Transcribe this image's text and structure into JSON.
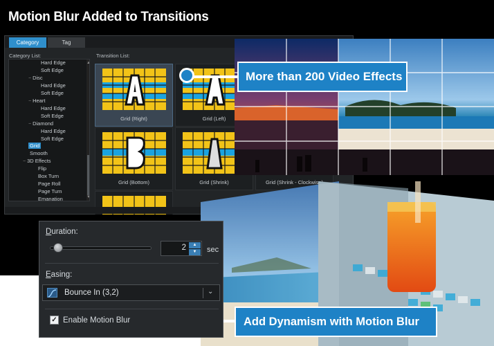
{
  "header": {
    "title": "Motion Blur Added to Transitions"
  },
  "panel": {
    "tabs": [
      {
        "label": "Category"
      },
      {
        "label": "Tag"
      }
    ],
    "category_list_label": "Category List:",
    "transition_list_label": "Transition List:",
    "tree_items": [
      {
        "label": "Hard Edge"
      },
      {
        "label": "Soft Edge"
      },
      {
        "label": "Disc"
      },
      {
        "label": "Hard Edge"
      },
      {
        "label": "Soft Edge"
      },
      {
        "label": "Heart"
      },
      {
        "label": "Hard Edge"
      },
      {
        "label": "Soft Edge"
      },
      {
        "label": "Diamond"
      },
      {
        "label": "Hard Edge"
      },
      {
        "label": "Soft Edge"
      },
      {
        "label": "Grid"
      },
      {
        "label": "Smooth"
      },
      {
        "label": "3D Effects"
      },
      {
        "label": "Flip"
      },
      {
        "label": "Box Turn"
      },
      {
        "label": "Page Roll"
      },
      {
        "label": "Page Turn"
      },
      {
        "label": "Emanation"
      }
    ],
    "transitions": [
      {
        "label": "Grid (Right)"
      },
      {
        "label": "Grid (Left)"
      },
      {
        "label": "Grid (Bottom)"
      },
      {
        "label": "Grid (Shrink)"
      },
      {
        "label": "Grid (Shrink - Clockwise)"
      }
    ]
  },
  "callouts": {
    "top": "More than 200 Video Effects",
    "bottom": "Add Dynamism with Motion Blur"
  },
  "dialog": {
    "duration_label_key": "D",
    "duration_label_rest": "uration:",
    "duration_value": "2",
    "duration_unit": "sec",
    "easing_label_key": "E",
    "easing_label_rest": "asing:",
    "easing_value": "Bounce In (3,2)",
    "motion_blur_label": "Enable Motion Blur",
    "motion_blur_checked": true
  },
  "colors": {
    "accent": "#1e82c6",
    "tab_active": "#2f8fcc",
    "thumb_yellow": "#f2c318",
    "thumb_blue": "#1aa3e0"
  },
  "icons": {
    "spin_up": "▲",
    "spin_down": "▼",
    "dropdown": "chevron-down",
    "checkmark": "✓",
    "easing_curve": "easing-curve-icon"
  }
}
